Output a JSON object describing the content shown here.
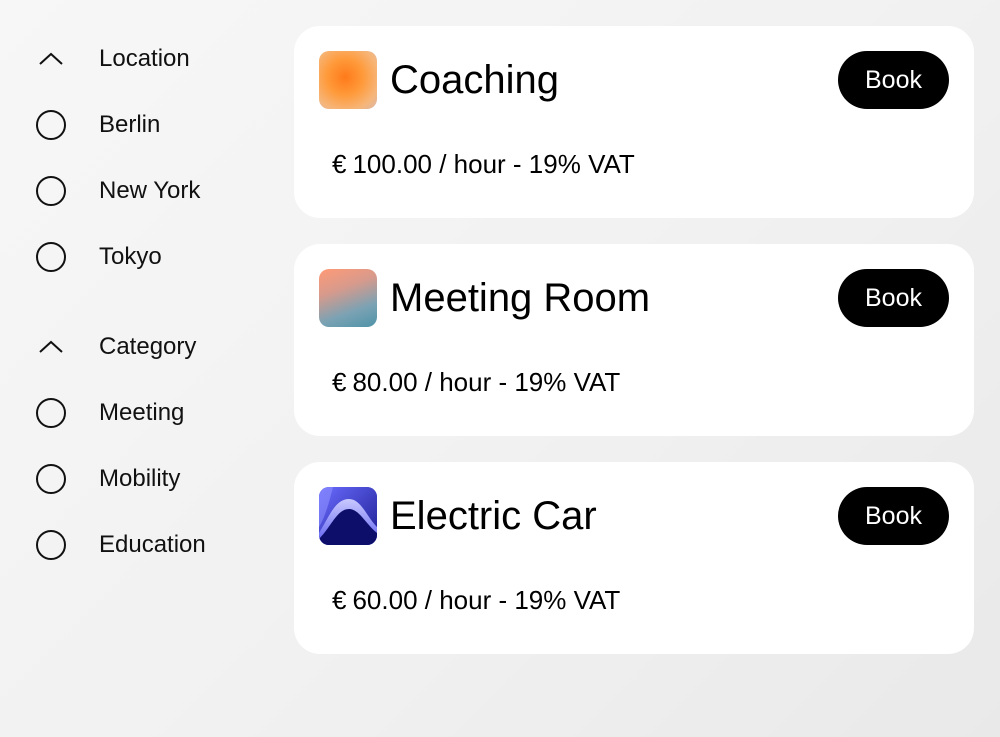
{
  "filters": {
    "location": {
      "label": "Location",
      "options": [
        {
          "label": "Berlin"
        },
        {
          "label": "New York"
        },
        {
          "label": "Tokyo"
        }
      ]
    },
    "category": {
      "label": "Category",
      "options": [
        {
          "label": "Meeting"
        },
        {
          "label": "Mobility"
        },
        {
          "label": "Education"
        }
      ]
    }
  },
  "listings": [
    {
      "title": "Coaching",
      "currency": "€",
      "price": "100.00 / hour - 19% VAT",
      "book_label": "Book",
      "icon": "coaching-thumbnail"
    },
    {
      "title": "Meeting Room",
      "currency": "€",
      "price": "80.00 / hour - 19% VAT",
      "book_label": "Book",
      "icon": "meeting-room-thumbnail"
    },
    {
      "title": "Electric Car",
      "currency": "€",
      "price": "60.00 / hour - 19% VAT",
      "book_label": "Book",
      "icon": "electric-car-thumbnail"
    }
  ],
  "colors": {
    "button_bg": "#000000",
    "button_text": "#ffffff",
    "card_bg": "#ffffff"
  }
}
